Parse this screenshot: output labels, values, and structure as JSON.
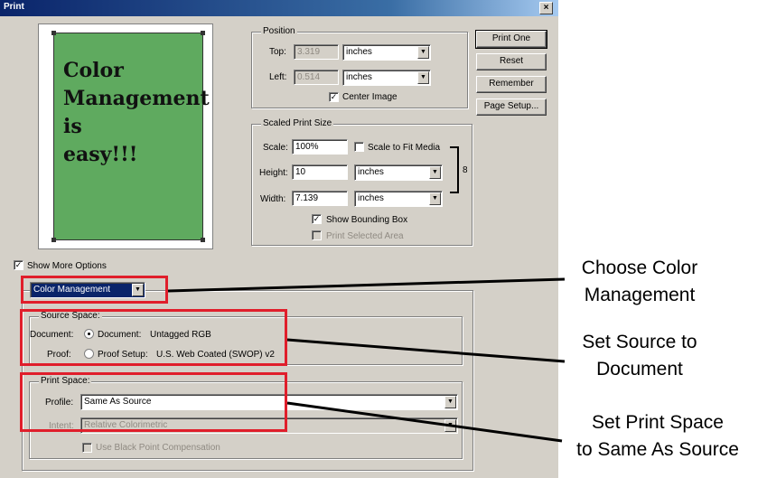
{
  "window": {
    "title": "Print",
    "close_glyph": "×"
  },
  "preview": {
    "text": "Color\nManagement\nis\neasy!!!",
    "page_color": "#5faa5f"
  },
  "position": {
    "legend": "Position",
    "top_label": "Top:",
    "top_value": "3.319",
    "top_unit": "inches",
    "left_label": "Left:",
    "left_value": "0.514",
    "left_unit": "inches",
    "center_image_label": "Center Image",
    "center_image_checked": true
  },
  "scaled": {
    "legend": "Scaled Print Size",
    "scale_label": "Scale:",
    "scale_value": "100%",
    "scale_to_fit_label": "Scale to Fit Media",
    "height_label": "Height:",
    "height_value": "10",
    "height_unit": "inches",
    "width_label": "Width:",
    "width_value": "7.139",
    "width_unit": "inches",
    "link_glyph": "8",
    "show_bounding_box_label": "Show Bounding Box",
    "print_selected_area_label": "Print Selected Area"
  },
  "buttons": {
    "print_one": "Print One",
    "reset": "Reset",
    "remember": "Remember",
    "page_setup": "Page Setup..."
  },
  "options": {
    "show_more_label": "Show More Options",
    "show_more_checked": true,
    "dropdown_value": "Color Management"
  },
  "source_space": {
    "legend": "Source Space:",
    "document_label": "Document:",
    "document_radio_label": "Document:",
    "document_value": "Untagged RGB",
    "proof_label": "Proof:",
    "proof_radio_label": "Proof Setup:",
    "proof_value": "U.S. Web Coated (SWOP) v2"
  },
  "print_space": {
    "legend": "Print Space:",
    "profile_label": "Profile:",
    "profile_value": "Same As Source",
    "intent_label": "Intent:",
    "intent_value": "Relative Colorimetric",
    "black_point_label": "Use Black Point Compensation"
  },
  "annotations": {
    "choose": "Choose Color\nManagement",
    "source": "Set Source to\nDocument",
    "print": "Set Print Space\nto Same As Source"
  },
  "colors": {
    "dialog_bg": "#d4d0c8",
    "highlight_red": "#e01e2b",
    "selection_blue": "#0a246a"
  }
}
